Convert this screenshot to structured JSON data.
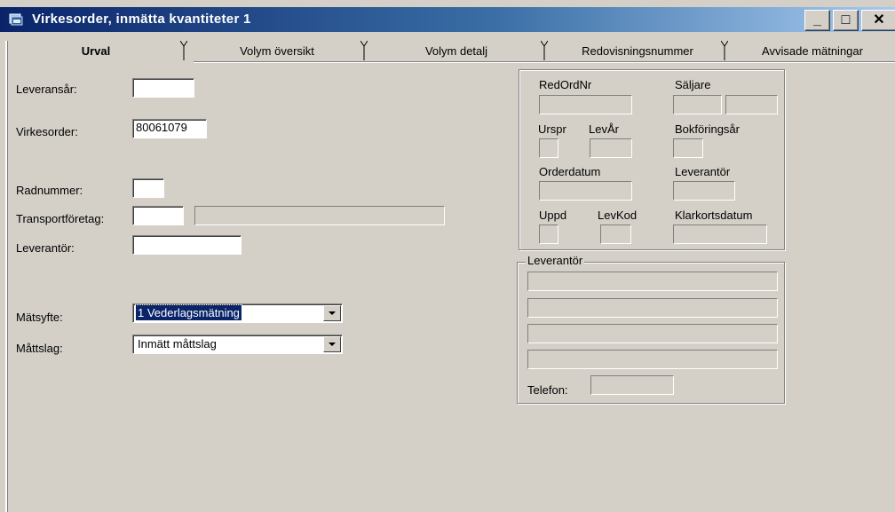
{
  "window": {
    "title": "Virkesorder, inmätta kvantiteter 1",
    "minimize": "_",
    "maximize": "□",
    "close": "✕"
  },
  "tabs": [
    {
      "label": "Urval",
      "active": true
    },
    {
      "label": "Volym översikt",
      "active": false
    },
    {
      "label": "Volym detalj",
      "active": false
    },
    {
      "label": "Redovisningsnummer",
      "active": false
    },
    {
      "label": "Avvisade mätningar",
      "active": false
    }
  ],
  "form": {
    "leveransar_label": "Leveransår:",
    "leveransar_value": "",
    "virkesorder_label": "Virkesorder:",
    "virkesorder_value": "80061079",
    "radnummer_label": "Radnummer:",
    "radnummer_value": "",
    "transport_label": "Transportföretag:",
    "transport_code": "",
    "transport_name": "",
    "leverantor_label": "Leverantör:",
    "leverantor_value": "",
    "matsyfte_label": "Mätsyfte:",
    "matsyfte_value": "1 Vederlagsmätning",
    "mattslag_label": "Måttslag:",
    "mattslag_value": "Inmätt måttslag"
  },
  "info_panel": {
    "redordnr": "RedOrdNr",
    "saljare": "Säljare",
    "urspr": "Urspr",
    "levar": "LevÅr",
    "bokforingsar": "Bokföringsår",
    "orderdatum": "Orderdatum",
    "leverantor": "Leverantör",
    "uppd": "Uppd",
    "levkod": "LevKod",
    "klarkortsdatum": "Klarkortsdatum"
  },
  "leverantor_group": {
    "legend": "Leverantör",
    "telefon_label": "Telefon:"
  }
}
